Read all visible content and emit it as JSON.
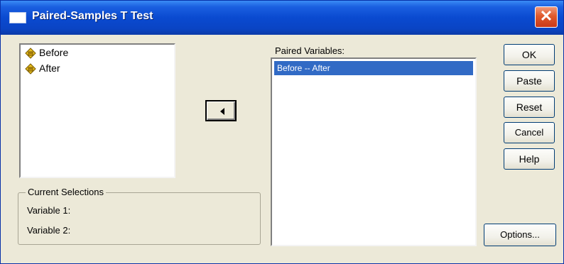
{
  "window": {
    "title": "Paired-Samples T Test",
    "close_symbol": "✕"
  },
  "source_variables": [
    {
      "label": "Before",
      "icon": "scale-variable-icon"
    },
    {
      "label": "After",
      "icon": "scale-variable-icon"
    }
  ],
  "current_selections": {
    "legend": "Current Selections",
    "variable1_label": "Variable 1:",
    "variable2_label": "Variable 2:"
  },
  "paired_variables": {
    "label": "Paired Variables:",
    "items": [
      "Before -- After"
    ]
  },
  "buttons": {
    "ok": "OK",
    "paste": "Paste",
    "reset": "Reset",
    "cancel": "Cancel",
    "help": "Help",
    "options": "Options..."
  },
  "colors": {
    "title_bar": "#0a4ad0",
    "selection": "#316ac5",
    "dialog_bg": "#ece9d8"
  }
}
